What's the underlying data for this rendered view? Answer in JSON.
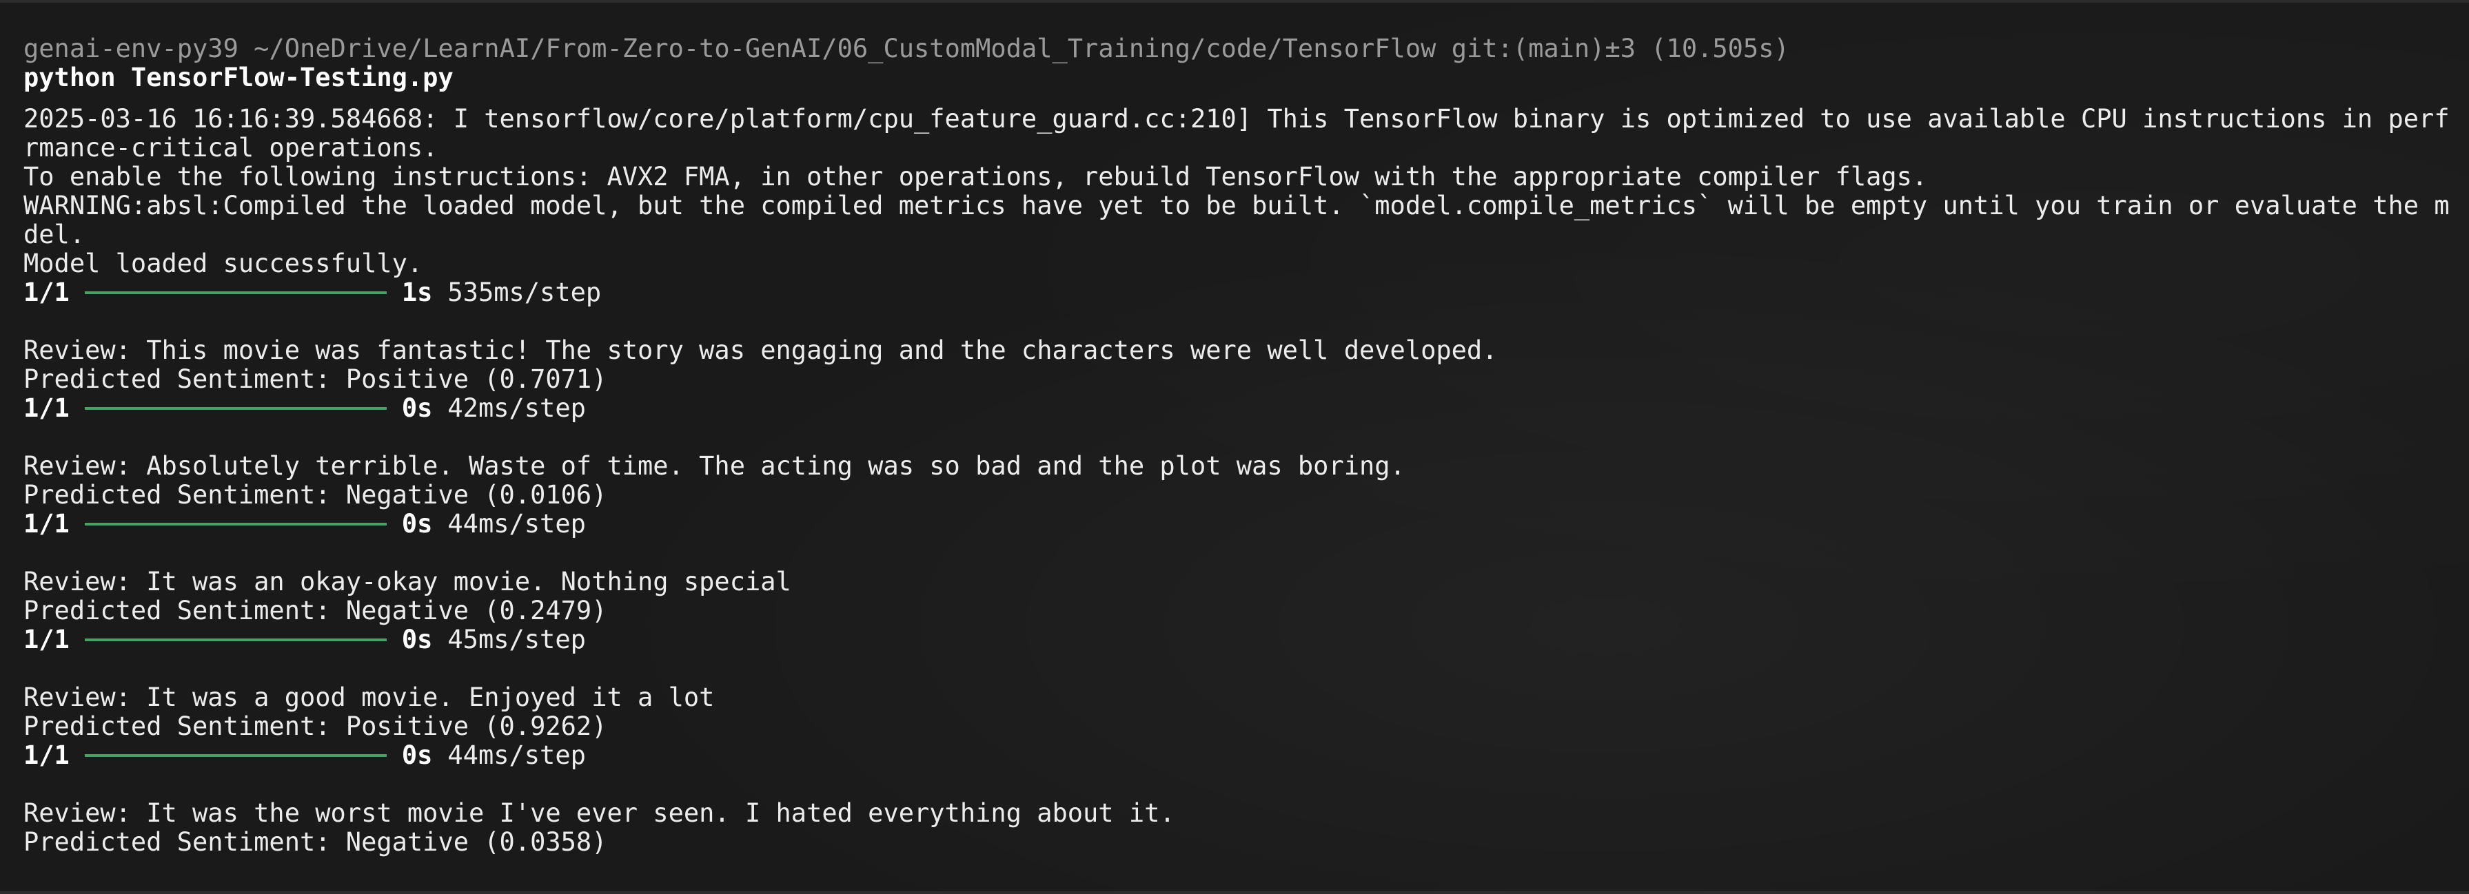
{
  "prompt": {
    "env": "genai-env-py39",
    "path": "~/OneDrive/LearnAI/From-Zero-to-GenAI/06_CustomModal_Training/code/TensorFlow",
    "git": "git:(main)±3",
    "duration": "(10.505s)"
  },
  "command": "python TensorFlow-Testing.py",
  "log": [
    "2025-03-16 16:16:39.584668: I tensorflow/core/platform/cpu_feature_guard.cc:210] This TensorFlow binary is optimized to use available CPU instructions in perfo",
    "rmance-critical operations.",
    "To enable the following instructions: AVX2 FMA, in other operations, rebuild TensorFlow with the appropriate compiler flags.",
    "WARNING:absl:Compiled the loaded model, but the compiled metrics have yet to be built. `model.compile_metrics` will be empty until you train or evaluate the mo",
    "del.",
    "Model loaded successfully."
  ],
  "progress": [
    {
      "count": "1/1",
      "time": "1s",
      "rate": "535ms/step",
      "fraction": 1.0
    },
    {
      "count": "1/1",
      "time": "0s",
      "rate": "42ms/step",
      "fraction": 1.0
    },
    {
      "count": "1/1",
      "time": "0s",
      "rate": "44ms/step",
      "fraction": 1.0
    },
    {
      "count": "1/1",
      "time": "0s",
      "rate": "45ms/step",
      "fraction": 1.0
    },
    {
      "count": "1/1",
      "time": "0s",
      "rate": "44ms/step",
      "fraction": 1.0
    }
  ],
  "results": [
    {
      "review": "Review: This movie was fantastic! The story was engaging and the characters were well developed.",
      "prediction": "Predicted Sentiment: Positive (0.7071)"
    },
    {
      "review": "Review: Absolutely terrible. Waste of time. The acting was so bad and the plot was boring.",
      "prediction": "Predicted Sentiment: Negative (0.0106)"
    },
    {
      "review": "Review: It was an okay-okay movie. Nothing special",
      "prediction": "Predicted Sentiment: Negative (0.2479)"
    },
    {
      "review": "Review: It was a good movie. Enjoyed it a lot",
      "prediction": "Predicted Sentiment: Positive (0.9262)"
    },
    {
      "review": "Review: It was the worst movie I've ever seen. I hated everything about it.",
      "prediction": "Predicted Sentiment: Negative (0.0358)"
    }
  ],
  "colors": {
    "background": "#1a1a1a",
    "text": "#ececec",
    "prompt": "#9a9a9a",
    "progress_bar": "#4aa066"
  }
}
